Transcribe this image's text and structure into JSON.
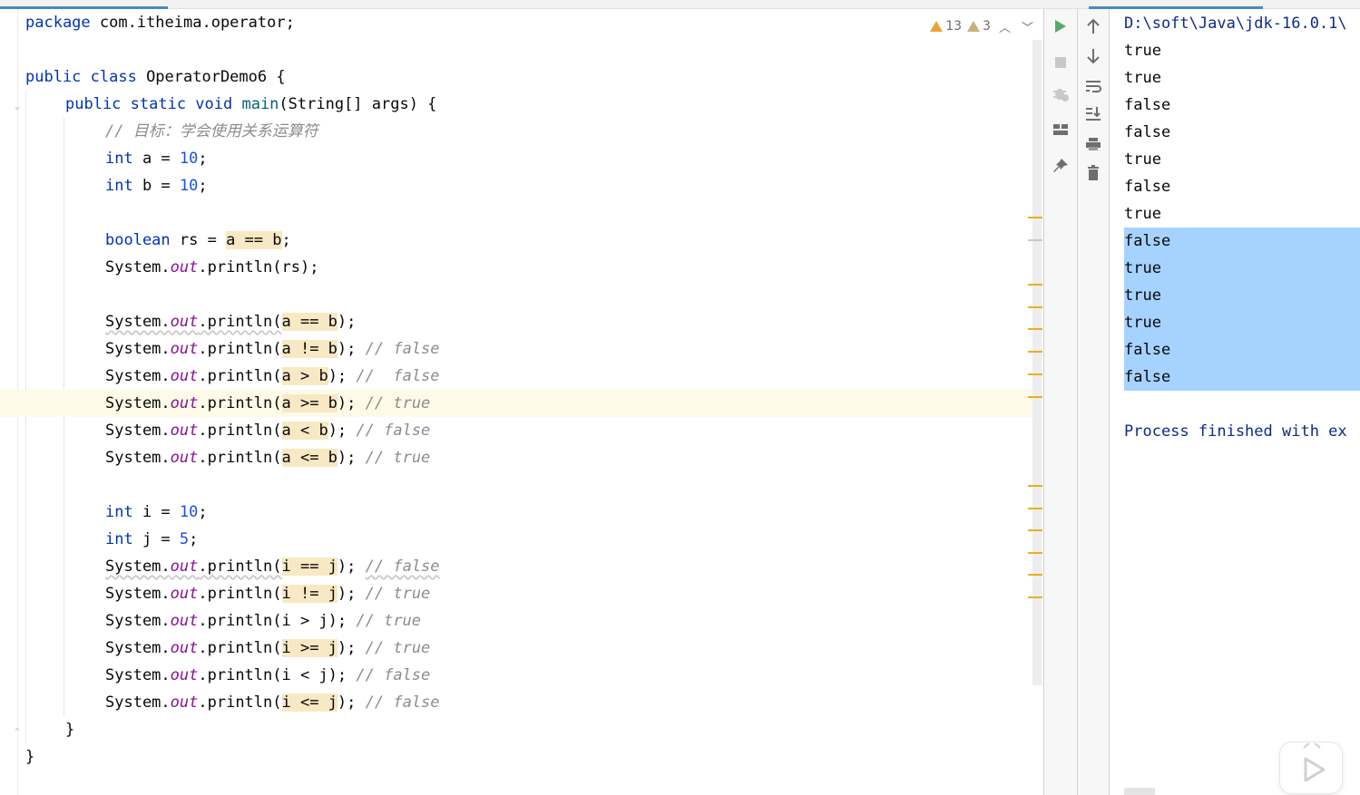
{
  "editor": {
    "inspections": {
      "warnings_count": "13",
      "weak_warnings_count": "3"
    },
    "lines": {
      "l1": "package com.itheima.operator;",
      "l3": "public class OperatorDemo6 {",
      "l4": "public static void main(String[] args) {",
      "l5": "// 目标：学会使用关系运算符",
      "l6": "int a = 10;",
      "l7": "int b = 10;",
      "l9": "boolean rs = a == b;",
      "l10": "System.out.println(rs);",
      "l12": "System.out.println(a == b);",
      "l13": "System.out.println(a != b); // false",
      "l14": "System.out.println(a > b); //  false",
      "l15": "System.out.println(a >= b); // true",
      "l16": "System.out.println(a < b); // false",
      "l17": "System.out.println(a <= b); // true",
      "l19": "int i = 10;",
      "l20": "int j = 5;",
      "l21": "System.out.println(i == j); // false",
      "l22": "System.out.println(i != j); // true",
      "l23": "System.out.println(i > j); // true",
      "l24": "System.out.println(i >= j); // true",
      "l25": "System.out.println(i < j); // false",
      "l26": "System.out.println(i <= j); // false",
      "l27": "}",
      "l28": "}"
    }
  },
  "toolbar": {
    "left_icons": [
      "run-icon",
      "stop-icon",
      "debug-icon",
      "layout-icon",
      "pin-icon"
    ],
    "right_icons": [
      "up-arrow-icon",
      "down-arrow-icon",
      "soft-wrap-icon",
      "scroll-to-end-icon",
      "print-icon",
      "trash-icon"
    ]
  },
  "console": {
    "path": "D:\\soft\\Java\\jdk-16.0.1\\",
    "output": [
      "true",
      "true",
      "false",
      "false",
      "true",
      "false",
      "true",
      "false",
      "true",
      "true",
      "true",
      "false",
      "false"
    ],
    "selected_from_index": 7,
    "finished": "Process finished with ex"
  },
  "colors": {
    "keyword": "#0033b3",
    "number": "#1750eb",
    "static_field": "#871094",
    "comment": "#8c8c8c",
    "selection": "#a6d2ff",
    "warning": "#e8a33d"
  }
}
